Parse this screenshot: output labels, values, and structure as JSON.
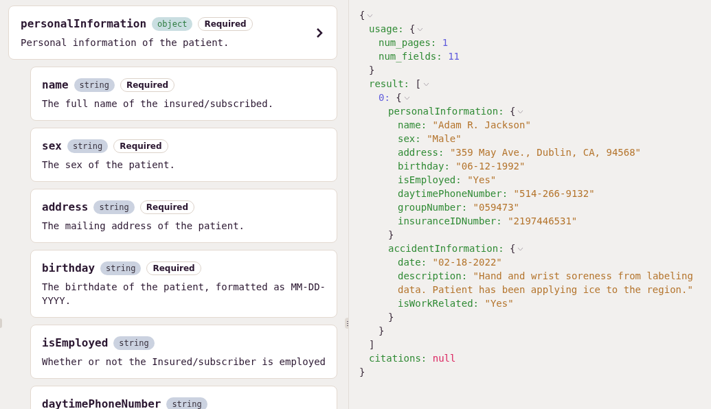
{
  "schema": {
    "name": "personalInformation",
    "type": "object",
    "color": "#2f7d42",
    "badge": "Required",
    "description": "Personal information of the patient.",
    "fields": [
      {
        "name": "name",
        "type": "string",
        "color": "#3b3440",
        "badge": "Required",
        "description": "The full name of the insured/subscribed."
      },
      {
        "name": "sex",
        "type": "string",
        "color": "#3b3440",
        "badge": "Required",
        "description": "The sex of the patient."
      },
      {
        "name": "address",
        "type": "string",
        "color": "#3b3440",
        "badge": "Required",
        "description": "The mailing address of the patient."
      },
      {
        "name": "birthday",
        "type": "string",
        "color": "#3b3440",
        "badge": "Required",
        "description": "The birthdate of the patient, formatted as MM-DD-YYYY."
      },
      {
        "name": "isEmployed",
        "type": "string",
        "color": "#3b3440",
        "description": "Whether or not the Insured/subscriber is employed"
      },
      {
        "name": "daytimePhoneNumber",
        "type": "string",
        "color": "#3b3440"
      }
    ]
  },
  "result_json": {
    "kind": "group",
    "open": "{",
    "close": "}",
    "expanded": true,
    "children": [
      {
        "kind": "group",
        "key": "usage:",
        "open": "{",
        "close": "}",
        "expanded": true,
        "children": [
          {
            "kind": "number",
            "key": "num_pages:",
            "value": "1"
          },
          {
            "kind": "number",
            "key": "num_fields:",
            "value": "11"
          }
        ]
      },
      {
        "kind": "group",
        "key": "result:",
        "open": "[",
        "close": "]",
        "expanded": true,
        "children": [
          {
            "kind": "group",
            "key": "0:",
            "index": true,
            "open": "{",
            "close": "}",
            "expanded": true,
            "children": [
              {
                "kind": "group",
                "key": "personalInformation:",
                "open": "{",
                "close": "}",
                "expanded": true,
                "children": [
                  {
                    "kind": "string",
                    "key": "name:",
                    "value": "\"Adam R. Jackson\""
                  },
                  {
                    "kind": "string",
                    "key": "sex:",
                    "value": "\"Male\""
                  },
                  {
                    "kind": "string",
                    "key": "address:",
                    "value": "\"359 May Ave., Dublin, CA, 94568\""
                  },
                  {
                    "kind": "string",
                    "key": "birthday:",
                    "value": "\"06-12-1992\""
                  },
                  {
                    "kind": "string",
                    "key": "isEmployed:",
                    "value": "\"Yes\""
                  },
                  {
                    "kind": "string",
                    "key": "daytimePhoneNumber:",
                    "value": "\"514-266-9132\""
                  },
                  {
                    "kind": "string",
                    "key": "groupNumber:",
                    "value": "\"059473\""
                  },
                  {
                    "kind": "string",
                    "key": "insuranceIDNumber:",
                    "value": "\"2197446531\""
                  }
                ]
              },
              {
                "kind": "group",
                "key": "accidentInformation:",
                "open": "{",
                "close": "}",
                "expanded": true,
                "children": [
                  {
                    "kind": "string",
                    "key": "date:",
                    "value": "\"02-18-2022\""
                  },
                  {
                    "kind": "string",
                    "key": "description:",
                    "value": "\"Hand and wrist soreness from labeling data. Patient has been applying ice to the region.\""
                  },
                  {
                    "kind": "string",
                    "key": "isWorkRelated:",
                    "value": "\"Yes\""
                  }
                ]
              }
            ]
          }
        ]
      },
      {
        "kind": "null",
        "key": "citations:",
        "value": "null"
      }
    ]
  }
}
